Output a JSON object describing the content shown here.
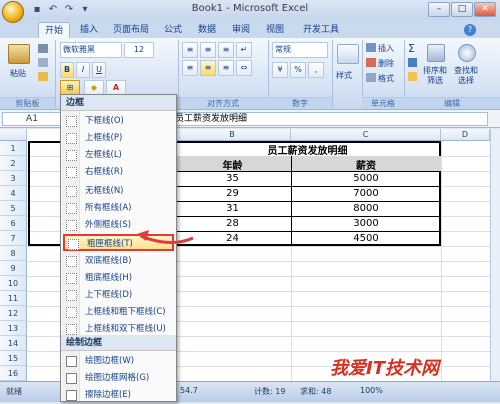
{
  "window": {
    "title": "Book1 - Microsoft Excel",
    "minimize": "–",
    "maximize": "□",
    "close": "✕"
  },
  "tabs": [
    "开始",
    "插入",
    "页面布局",
    "公式",
    "数据",
    "审阅",
    "视图",
    "开发工具"
  ],
  "ribbon": {
    "paste_label": "粘贴",
    "font_name": "微软雅黑",
    "font_size": "12",
    "number_format": "常规",
    "style_label": "样式",
    "insert_label": "插入",
    "delete_label": "删除",
    "format_label": "格式",
    "sort_label": "排序和\n筛选",
    "find_label": "查找和\n选择",
    "groups": {
      "clipboard": "剪贴板",
      "alignment": "对齐方式",
      "number": "数字",
      "cells": "单元格",
      "editing": "编辑"
    }
  },
  "formula_bar": {
    "name_box": "A1",
    "formula": "员工薪资发放明细"
  },
  "columns": [
    "B",
    "C",
    "D"
  ],
  "rows": [
    "1",
    "2",
    "3",
    "4",
    "5",
    "6",
    "7",
    "8",
    "9",
    "10",
    "11",
    "12",
    "13",
    "14",
    "15",
    "16"
  ],
  "table": {
    "title": "员工薪资发放明细",
    "headers": [
      "年龄",
      "薪资"
    ],
    "rows": [
      [
        "35",
        "5000"
      ],
      [
        "29",
        "7000"
      ],
      [
        "31",
        "8000"
      ],
      [
        "28",
        "3000"
      ],
      [
        "24",
        "4500"
      ]
    ]
  },
  "border_menu": {
    "header": "边框",
    "items": [
      "下框线(O)",
      "上框线(P)",
      "左框线(L)",
      "右框线(R)",
      "无框线(N)",
      "所有框线(A)",
      "外侧框线(S)",
      "粗匣框线(T)",
      "双底框线(B)",
      "粗底框线(H)",
      "上下框线(D)",
      "上框线和粗下框线(C)",
      "上框线和双下框线(U)"
    ],
    "highlighted_index": 7,
    "draw_header": "绘制边框",
    "draw_items": [
      "绘图边框(W)",
      "绘图边框网格(G)",
      "擦除边框(E)"
    ]
  },
  "status": {
    "ready": "就绪",
    "avg_fragment": "54.7",
    "count": "计数: 19",
    "sum": "求和: 48",
    "zoom": "100%"
  },
  "watermark": "我爱IT技术网",
  "colors": {
    "highlight_border": "#e23a3a",
    "arrow": "#e23a3a"
  }
}
